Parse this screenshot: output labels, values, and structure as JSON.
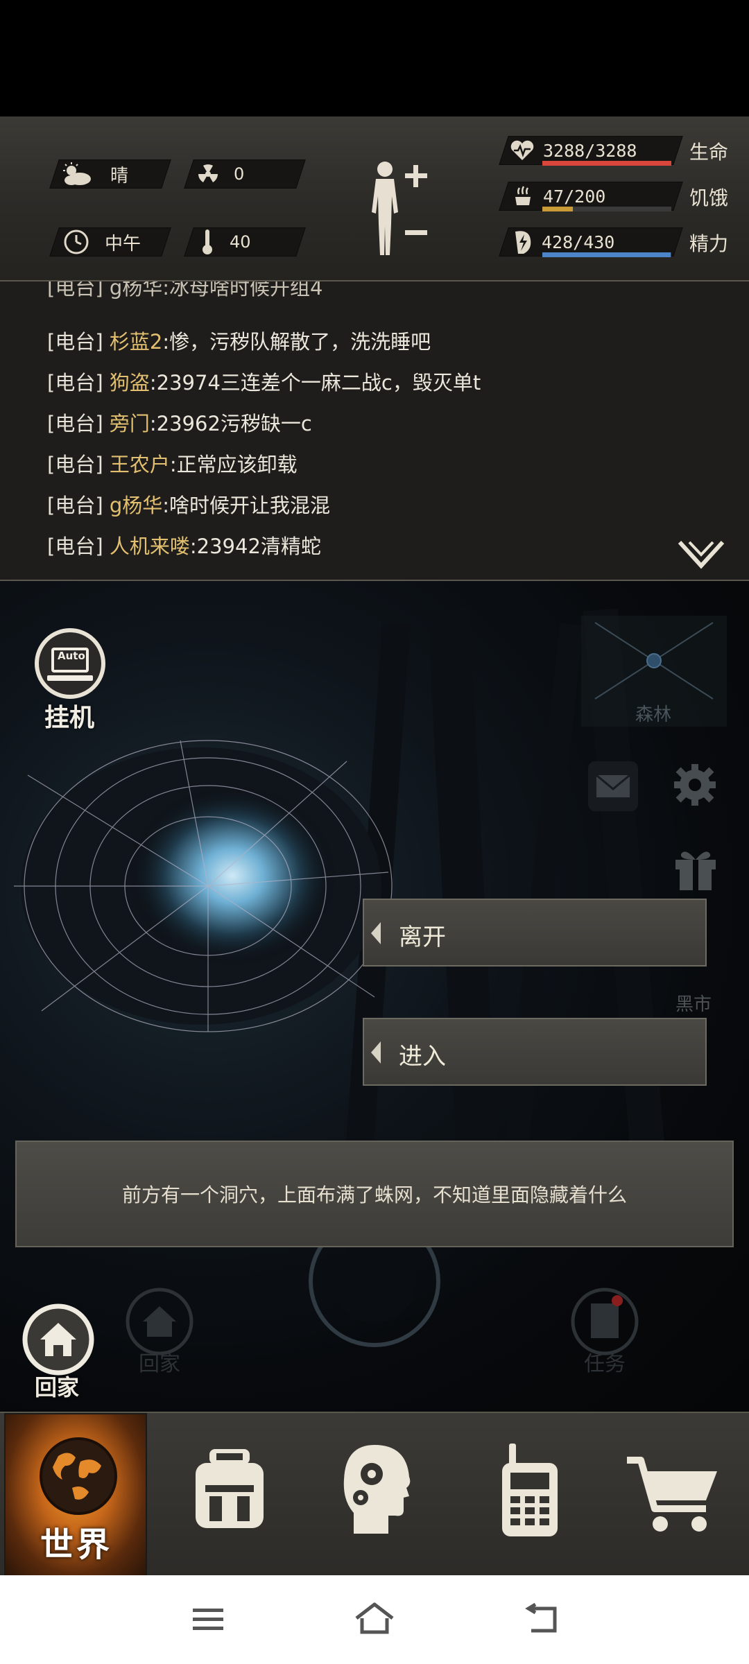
{
  "status": {
    "weather": "晴",
    "radiation": "0",
    "time_of_day": "中午",
    "temperature": "40",
    "life_value": "3288/3288",
    "life_label": "生命",
    "life_fraction": 1.0,
    "hunger_value": "47/200",
    "hunger_label": "饥饿",
    "hunger_fraction": 0.235,
    "energy_value": "428/430",
    "energy_label": "精力",
    "energy_fraction": 0.995,
    "colors": {
      "life": "#d9463b",
      "hunger": "#c99a36",
      "energy": "#4c86c9"
    }
  },
  "chat": {
    "partial_line": "[电台] g杨华:冰母啥时候开组4",
    "messages": [
      {
        "channel": "[电台]",
        "name": "杉蓝2",
        "text": ":惨，污秽队解散了，洗洗睡吧"
      },
      {
        "channel": "[电台]",
        "name": "狗盗",
        "text": ":23974三连差个一麻二战c，毁灭单t"
      },
      {
        "channel": "[电台]",
        "name": "旁门",
        "text": ":23962污秽缺一c"
      },
      {
        "channel": "[电台]",
        "name": "王农户",
        "text": ":正常应该卸载"
      },
      {
        "channel": "[电台]",
        "name": "g杨华",
        "text": ":啥时候开让我混混"
      },
      {
        "channel": "[电台]",
        "name": "人机来喽",
        "text": ":23942清精蛇"
      }
    ]
  },
  "scene": {
    "auto_label": "Auto",
    "idle_label": "挂机",
    "map_label": "森林",
    "black_market_label": "黑市",
    "leave_label": "离开",
    "enter_label": "进入",
    "description": "前方有一个洞穴，上面布满了蛛网，不知道里面隐藏着什么",
    "home_label": "回家",
    "home_label_ghost": "回家",
    "task_label": "任务"
  },
  "tabs": {
    "world": "世界"
  }
}
